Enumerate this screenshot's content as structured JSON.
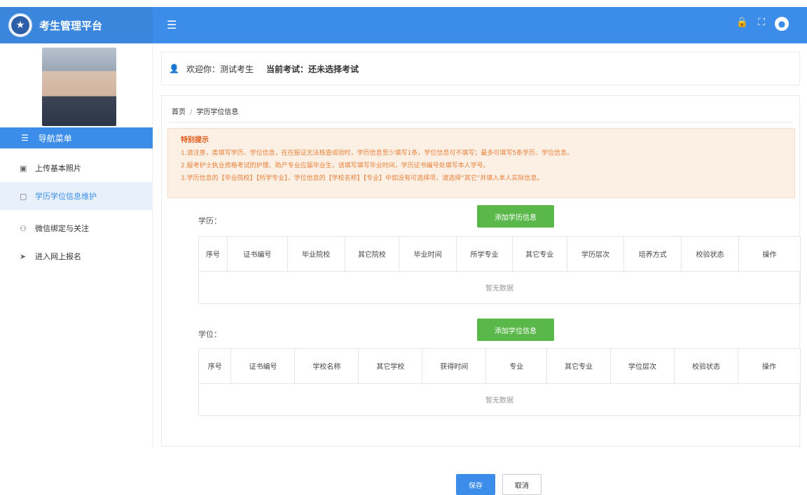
{
  "app": {
    "title": "考生管理平台"
  },
  "topbar": {
    "menu_icon": "hamburger-icon",
    "icons": [
      "lock-icon",
      "fullscreen-icon",
      "user-icon"
    ]
  },
  "sidebar": {
    "nav_header": "导航菜单",
    "items": [
      {
        "label": "上传基本照片",
        "icon": "image-icon"
      },
      {
        "label": "学历学位信息维护",
        "icon": "doc-icon",
        "active": true
      },
      {
        "label": "微信绑定与关注",
        "icon": "wechat-icon"
      },
      {
        "label": "进入网上报名",
        "icon": "send-icon"
      }
    ]
  },
  "welcome": {
    "greeting": "欢迎你：测试考生",
    "exam": "当前考试：还未选择考试"
  },
  "breadcrumb": {
    "home": "首页",
    "current": "学历学位信息"
  },
  "notice": {
    "title": "特别提示",
    "lines": [
      "1.请注意，类填写学历、学位信息，在在报证无法核查成验时，学历信息至少填写1条，学位信息可不填写；最多可填写5条学历、学位信息。",
      "2.报考护士执业资格考试的护理、助产专业应届毕业生，请填写填写毕业时间，学历证书编号处填写本人学号。",
      "3.学历信息的【毕业院校】【所学专业】，学位信息的【学校名称】【专业】中如没有可选择项，请选择“其它”并填入本人实际信息。"
    ]
  },
  "education": {
    "label": "学历：",
    "add_button": "添加学历信息",
    "columns": [
      "序号",
      "证书编号",
      "毕业院校",
      "其它院校",
      "毕业时间",
      "所学专业",
      "其它专业",
      "学历层次",
      "培养方式",
      "校验状态",
      "操作"
    ],
    "empty": "暂无数据"
  },
  "degree": {
    "label": "学位：",
    "add_button": "添加学位信息",
    "columns": [
      "序号",
      "证书编号",
      "学校名称",
      "其它学校",
      "获得时间",
      "专业",
      "其它专业",
      "学位层次",
      "校验状态",
      "操作"
    ],
    "empty": "暂无数据"
  },
  "actions": {
    "save": "保存",
    "cancel": "取消"
  }
}
